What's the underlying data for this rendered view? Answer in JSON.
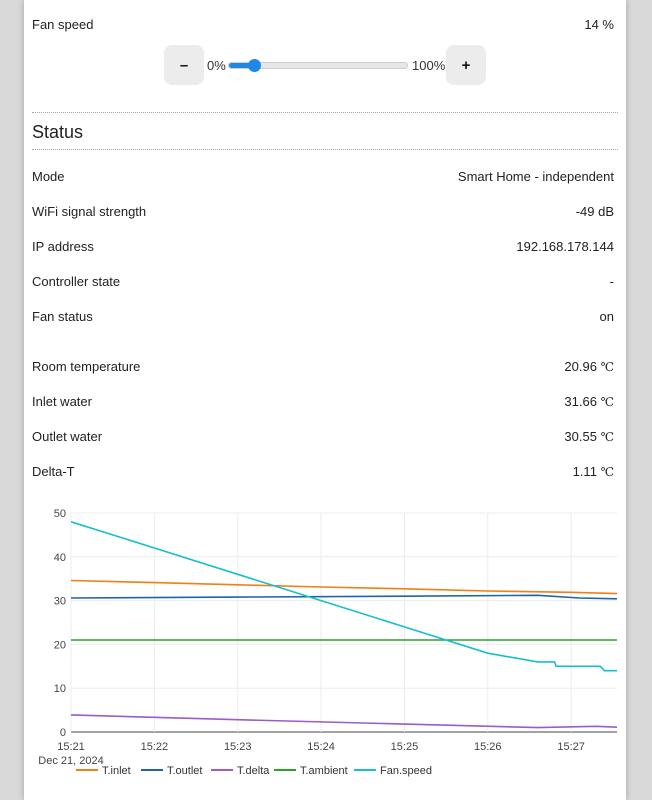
{
  "fan": {
    "label": "Fan speed",
    "value": "14 %",
    "level_percent": 14,
    "min_label": "0%",
    "max_label": "100%",
    "minus_label": "–",
    "plus_label": "+"
  },
  "status": {
    "title": "Status",
    "rows": [
      {
        "label": "Mode",
        "value": "Smart Home - independent"
      },
      {
        "label": "WiFi signal strength",
        "value": "-49 dB"
      },
      {
        "label": "IP address",
        "value": "192.168.178.144"
      },
      {
        "label": "Controller state",
        "value": "-"
      },
      {
        "label": "Fan status",
        "value": "on"
      }
    ],
    "temps": [
      {
        "label": "Room temperature",
        "value": "20.96",
        "unit": "℃"
      },
      {
        "label": "Inlet water",
        "value": "31.66",
        "unit": "℃"
      },
      {
        "label": "Outlet water",
        "value": "30.55",
        "unit": "℃"
      },
      {
        "label": "Delta-T",
        "value": "1.11",
        "unit": "℃"
      }
    ]
  },
  "chart_data": {
    "type": "line",
    "xlabel_date": "Dec 21, 2024",
    "x_ticks": [
      "15:21",
      "15:22",
      "15:23",
      "15:24",
      "15:25",
      "15:26",
      "15:27"
    ],
    "y_ticks": [
      0,
      10,
      20,
      30,
      40,
      50
    ],
    "ylim": [
      0,
      50
    ],
    "xlim_minutes": [
      0,
      6.55
    ],
    "grid": true,
    "legend_position": "bottom",
    "series": [
      {
        "name": "T.inlet",
        "color": "#f07f14",
        "points": [
          [
            0,
            34.6
          ],
          [
            1,
            34.1
          ],
          [
            2,
            33.6
          ],
          [
            3,
            33.1
          ],
          [
            4,
            32.7
          ],
          [
            5,
            32.2
          ],
          [
            6,
            31.9
          ],
          [
            6.55,
            31.6
          ]
        ]
      },
      {
        "name": "T.outlet",
        "color": "#1f63a8",
        "points": [
          [
            0,
            30.6
          ],
          [
            2,
            30.8
          ],
          [
            4,
            31.0
          ],
          [
            5.6,
            31.2
          ],
          [
            6.1,
            30.6
          ],
          [
            6.55,
            30.4
          ]
        ]
      },
      {
        "name": "T.delta",
        "color": "#9a5cc9",
        "points": [
          [
            0,
            3.9
          ],
          [
            2,
            2.8
          ],
          [
            4,
            1.8
          ],
          [
            5.6,
            1.0
          ],
          [
            6.3,
            1.3
          ],
          [
            6.55,
            1.1
          ]
        ]
      },
      {
        "name": "T.ambient",
        "color": "#2ca02c",
        "points": [
          [
            0,
            21.0
          ],
          [
            6.55,
            21.0
          ]
        ]
      },
      {
        "name": "Fan.speed",
        "color": "#17becf",
        "points": [
          [
            0,
            48
          ],
          [
            1,
            42
          ],
          [
            2,
            36
          ],
          [
            3,
            30
          ],
          [
            4,
            24
          ],
          [
            5,
            18
          ],
          [
            5.6,
            16
          ],
          [
            5.8,
            16
          ],
          [
            5.82,
            15
          ],
          [
            6.35,
            15
          ],
          [
            6.4,
            14
          ],
          [
            6.55,
            14
          ]
        ]
      }
    ]
  }
}
